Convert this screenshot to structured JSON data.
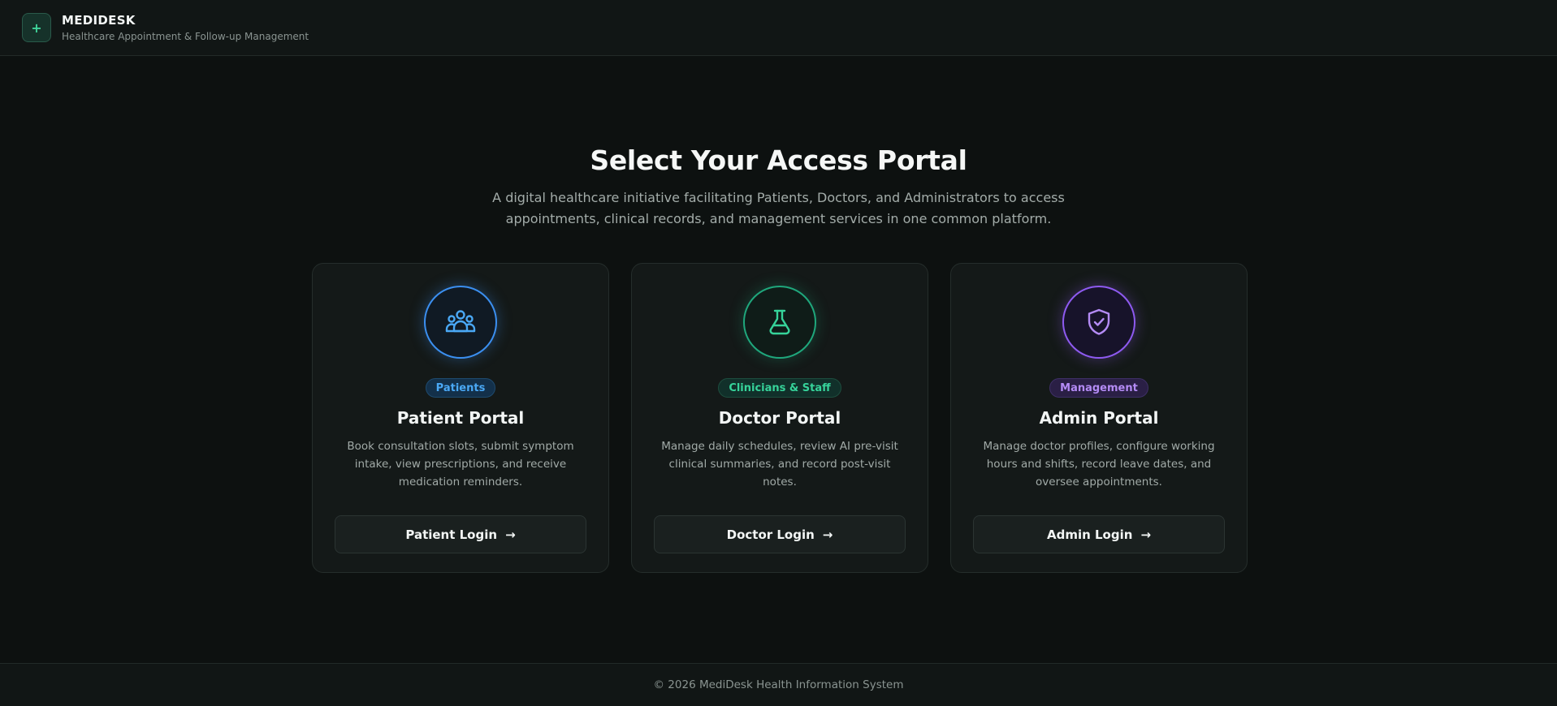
{
  "header": {
    "logo_glyph": "+",
    "brand_name": "MEDIDESK",
    "brand_subtitle": "Healthcare Appointment & Follow-up Management"
  },
  "hero": {
    "title": "Select Your Access Portal",
    "description": "A digital healthcare initiative facilitating Patients, Doctors, and Administrators to access appointments, clinical records, and management services in one common platform."
  },
  "portals": [
    {
      "icon": "users-group-icon",
      "accent": "#3b8ff0",
      "badge": "Patients",
      "title": "Patient Portal",
      "description": "Book consultation slots, submit symptom intake, view prescriptions, and receive medication reminders.",
      "button_label": "Patient Login",
      "button_arrow": "→"
    },
    {
      "icon": "flask-icon",
      "accent": "#1fa77c",
      "badge": "Clinicians & Staff",
      "title": "Doctor Portal",
      "description": "Manage daily schedules, review AI pre-visit clinical summaries, and record post-visit notes.",
      "button_label": "Doctor Login",
      "button_arrow": "→"
    },
    {
      "icon": "shield-check-icon",
      "accent": "#8e5af0",
      "badge": "Management",
      "title": "Admin Portal",
      "description": "Manage doctor profiles, configure working hours and shifts, record leave dates, and oversee appointments.",
      "button_label": "Admin Login",
      "button_arrow": "→"
    }
  ],
  "footer": {
    "copyright": "© 2026 MediDesk Health Information System"
  }
}
